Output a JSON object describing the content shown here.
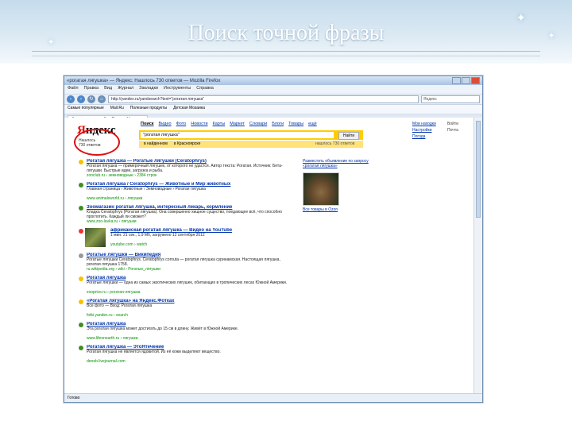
{
  "slide": {
    "title": "Поиск точной фразы"
  },
  "browser": {
    "window_title": "«рогатая лягушка» — Яндекс: Нашлось 730 ответов — Mozilla Firefox",
    "menu": [
      "Файл",
      "Правка",
      "Вид",
      "Журнал",
      "Закладки",
      "Инструменты",
      "Справка"
    ],
    "url": "http://yandex.ru/yandsearch?text=\"рогатая лягушка\"",
    "search_box_placeholder": "Яндекс",
    "bookmarks": [
      "Самые популярные",
      "Mail.Ru",
      "Полезные продукты",
      "Детская Мозаика"
    ],
    "tab": "\"рогатая лягушка\" — Яндекс: Нашло...",
    "status": "Готово"
  },
  "yandex": {
    "logo_first": "Я",
    "logo_rest": "ндекс",
    "logo_sub_1": "Нашлось",
    "logo_sub_2": "730 ответов",
    "services": [
      "Поиск",
      "Видео",
      "Фото",
      "Новости",
      "Карты",
      "Маркет",
      "Словари",
      "Блоги",
      "Товары",
      "ещё"
    ],
    "query": "\"рогатая лягушка\"",
    "search_button": "Найти",
    "option_region": "в найденном",
    "option_place": "в Красноярске",
    "found_text": "нашлось 730 ответов",
    "top_links": [
      "Мои находки",
      "Настройки",
      "Погода"
    ],
    "top_right": [
      "Войти",
      "Почта"
    ]
  },
  "results": [
    {
      "title": "Рогатая лягушка — Рогатые лягушки (Ceratophrys)",
      "snippet": "Рогатая лягушка — примерочный лягушек, от которого не удастся. Автор текста: Рогатая. Источник: Бета-лягушки. Быстрые идеи, загрузка и рыба.",
      "url": "zooclub.ru › земноводные › 2384 строк",
      "icon": "#f7c200"
    },
    {
      "title": "Рогатая лягушка / Ceratophrys — Животные и Мир животных",
      "snippet": "Главная страница › Животные › Земноводные › Рогатая лягушка",
      "url": "www.animalsworld.ru › лягушки",
      "icon": "#3f8f1f"
    },
    {
      "title": "Зоомагазин рогатая лягушка, интересный лекарь, кормление",
      "snippet": "Кладка Ceratophrys (Рогатая лягушка). Она совершенно хищное существо, поедающее всё, что способно проглотить. Каждый ли сможет?",
      "url": "www.zoo-lavka.ru › лягушки",
      "icon": "#3f8f1f"
    },
    {
      "title": "африканская рогатая лягушка — Видео на YouTube",
      "snippet": "1 мин. 21 сек., 1,9 Мб, загружено 12 сентября 2012",
      "url": "youtube.com › watch",
      "icon": "#e33"
    },
    {
      "title": "Рогатые лягушки — Википедия",
      "snippet": "Рогатые лягушки Ceratophrys. Ceratophrys cornuta — рогатая лягушка суринамская. Настоящая лягушка, рогатая лягушка 1758.",
      "url": "ru.wikipedia.org › wiki › Рогатые_лягушки",
      "icon": "#999"
    },
    {
      "title": "Рогатая лягушка",
      "snippet": "Рогатые лягушки — одна из самых экзотических лягушек, обитающих в тропических лесах Южной Америки.",
      "url": "zooprice.ru › рогатая-лягушка",
      "icon": "#f7c200"
    },
    {
      "title": "«Рогатая лягушка» на Яндекс.Фотках",
      "snippet": "Все фото — Вход: Рогатая лягушка",
      "url": "fotki.yandex.ru › search",
      "icon": "#f7c200"
    },
    {
      "title": "Рогатая лягушка",
      "snippet": "Эта рогатая лягушка может достигать до 15 см в длину. Живёт в Южной Америке.",
      "url": "www.lifeonearth.ru › лягушки",
      "icon": "#3f8f1f"
    },
    {
      "title": "Рогатая лягушка — ЭтоЯтечение",
      "snippet": "Рогатая лягушка не является ядовитой. Из её кожи выделяют вещество.",
      "url": "deneb.livejournal.com",
      "icon": "#3f8f1f"
    }
  ],
  "sidebar": {
    "ad_title": "Разместить объявление по запросу «рогатая лягушка»",
    "ozon": "Все товары в Ozon",
    "image_alt": "рогатая лягушка"
  }
}
